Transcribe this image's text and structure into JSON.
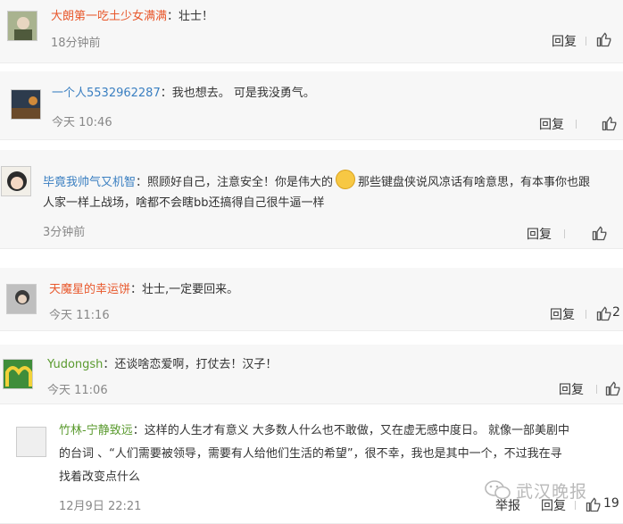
{
  "comments": [
    {
      "name": "大朗第一吃土少女满满",
      "sep": "：",
      "text": "壮士！",
      "time": "18分钟前",
      "reply": "回复"
    },
    {
      "name": "一个人5532962287",
      "sep": "：",
      "text": "我也想去。 可是我没勇气。",
      "time": "今天 10:46",
      "reply": "回复"
    },
    {
      "name": "毕竟我帅气又机智",
      "sep": "：",
      "text1": "照顾好自己，注意安全！你是伟大的",
      "text1b": "那些键盘侠说风凉话有啥意思，有本事你也跟",
      "text2": "人家一样上战场，啥都不会瞎bb还搞得自己很牛逼一样",
      "time": "3分钟前",
      "reply": "回复"
    },
    {
      "name": "天魔星的幸运饼",
      "sep": "：",
      "text": "壮士,一定要回来。",
      "time": "今天 11:16",
      "reply": "回复",
      "likes": "2"
    },
    {
      "name": "Yudongsh",
      "sep": "：",
      "text": "还谈啥恋爱啊，打仗去！汉子！",
      "time": "今天 11:06",
      "reply": "回复"
    },
    {
      "name": "竹林-宁静致远",
      "sep": "：",
      "text1": "这样的人生才有意义 大多数人什么也不敢做，又在虚无感中度日。 就像一部美剧中",
      "text2": "的台词 、“人们需要被领导，需要有人给他们生活的希望”，很不幸，我也是其中一个，不过我在寻",
      "text3": "找着改变点什么",
      "time": "12月9日 22:21",
      "report": "举报",
      "reply": "回复",
      "likes": "19"
    }
  ],
  "watermark": "武汉晚报",
  "icons": {
    "like": "thumbs-up-icon",
    "watermark": "wechat-icon"
  }
}
